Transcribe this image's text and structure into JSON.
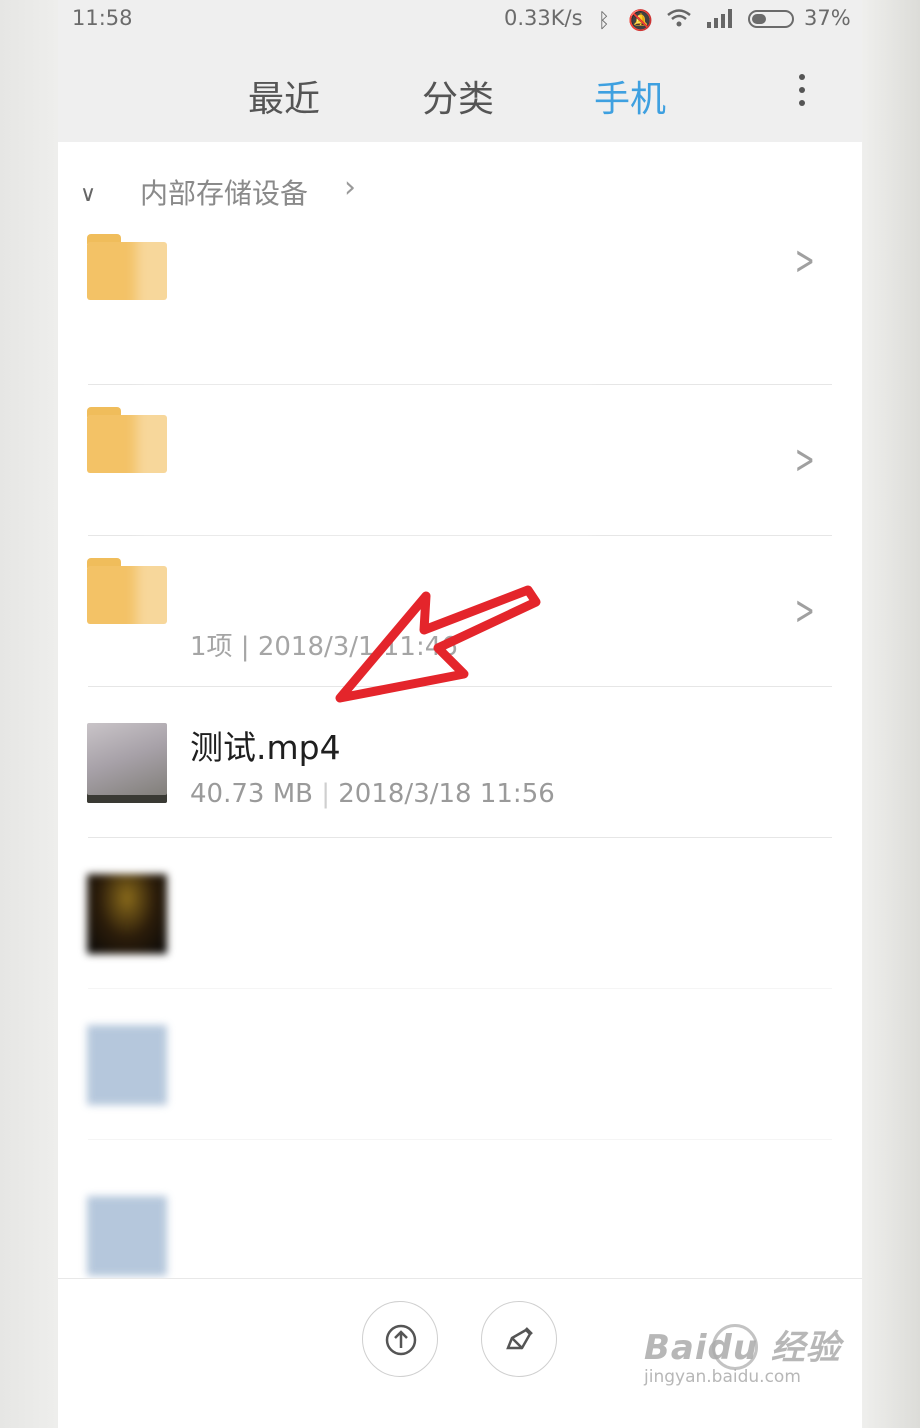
{
  "status_bar": {
    "time": "11:58",
    "net_speed": "0.33K/s",
    "battery_pct": "37%",
    "battery_level": 0.37,
    "icons": [
      "bluetooth-icon",
      "mute-icon",
      "wifi-icon",
      "signal-icon",
      "battery-icon"
    ]
  },
  "tabs": [
    {
      "label": "最近",
      "active": false
    },
    {
      "label": "分类",
      "active": false
    },
    {
      "label": "手机",
      "active": true
    }
  ],
  "accent_color": "#3ea0e0",
  "breadcrumb": {
    "path": "内部存储设备"
  },
  "files": [
    {
      "type": "folder",
      "name": "",
      "meta": ""
    },
    {
      "type": "folder",
      "name": "",
      "meta": ""
    },
    {
      "type": "folder",
      "name": "",
      "meta": "1项 | 2018/3/1 11:46"
    },
    {
      "type": "video",
      "name": "测试.mp4",
      "size": "40.73 MB",
      "date": "2018/3/18 11:56"
    },
    {
      "type": "file",
      "name": "",
      "meta": ""
    },
    {
      "type": "file",
      "name": "",
      "meta": ""
    },
    {
      "type": "file",
      "name": "",
      "meta": ""
    }
  ],
  "watermark": {
    "brand": "Baidu 经验",
    "site": "jingyan.baidu.com"
  }
}
